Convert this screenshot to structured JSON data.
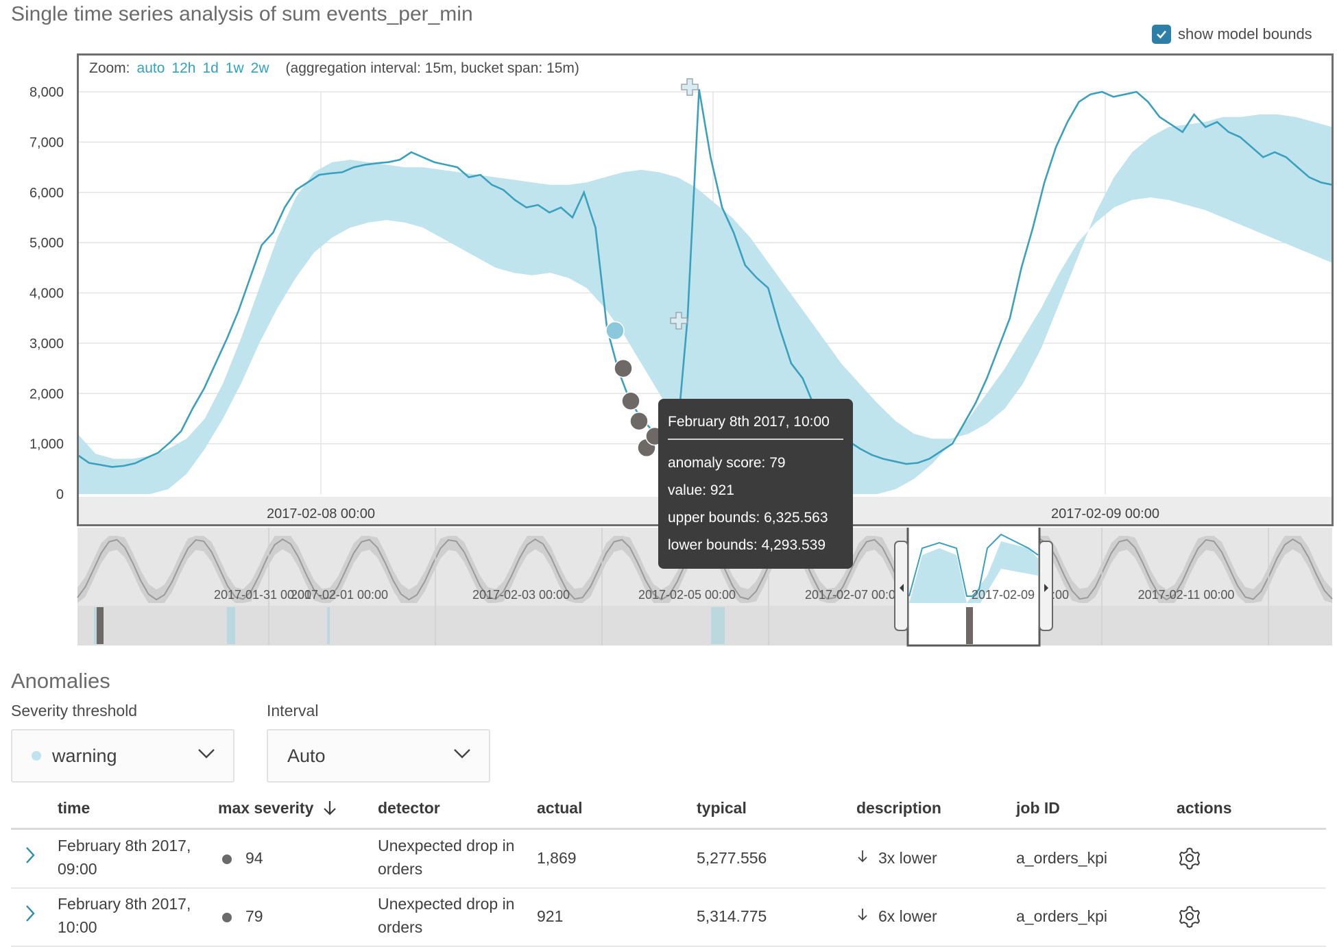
{
  "page": {
    "title": "Single time series analysis of sum events_per_min",
    "show_model_bounds_label": "show model bounds",
    "show_model_bounds_checked": true
  },
  "zoom": {
    "label": "Zoom:",
    "options": [
      "auto",
      "12h",
      "1d",
      "1w",
      "2w"
    ],
    "note": "(aggregation interval: 15m, bucket span: 15m)"
  },
  "colors": {
    "line": "#3aa0be",
    "band": "#bfe4ee",
    "anomaly_dot": "#6e6867",
    "warning_dot": "#8cc8dc",
    "accent": "#2fa3bd"
  },
  "chart_data": {
    "type": "line",
    "ylim": [
      0,
      8000
    ],
    "y_ticks": [
      "8,000",
      "7,000",
      "6,000",
      "5,000",
      "4,000",
      "3,000",
      "2,000",
      "1,000",
      "0"
    ],
    "x_ticks": [
      "2017-02-08 00:00",
      "2017-02-09 00:00"
    ],
    "series": [
      {
        "values": [
          780,
          620,
          580,
          540,
          560,
          610,
          720,
          820,
          1020,
          1250,
          1700,
          2100,
          2600,
          3100,
          3650,
          4300,
          4950,
          5200,
          5700,
          6050,
          6200,
          6350,
          6380,
          6400,
          6500,
          6550,
          6580,
          6600,
          6650,
          6800,
          6700,
          6600,
          6550,
          6500,
          6300,
          6350,
          6150,
          6050,
          5850,
          5700,
          5750,
          5600,
          5700,
          5500,
          6000,
          5300,
          3300,
          2450,
          1850,
          1500,
          1250,
          1150,
          921,
          3500,
          8050,
          6700,
          5700,
          5200,
          4550,
          4300,
          4100,
          3300,
          2600,
          2300,
          1750,
          1500,
          1300,
          1050,
          900,
          780,
          700,
          650,
          600,
          620,
          700,
          850,
          1000,
          1400,
          1800,
          2300,
          2900,
          3500,
          4500,
          5300,
          6200,
          6900,
          7400,
          7800,
          7950,
          8000,
          7900,
          7950,
          8000,
          7800,
          7500,
          7350,
          7200,
          7550,
          7300,
          7400,
          7200,
          7100,
          6900,
          6700,
          6800,
          6700,
          6500,
          6300,
          6200,
          6150
        ]
      }
    ],
    "model_bounds_upper": [
      1200,
      800,
      700,
      700,
      760,
      900,
      1100,
      1500,
      2200,
      3100,
      4100,
      5100,
      5900,
      6400,
      6600,
      6650,
      6600,
      6550,
      6500,
      6500,
      6450,
      6400,
      6350,
      6300,
      6250,
      6200,
      6150,
      6150,
      6200,
      6300,
      6400,
      6450,
      6400,
      6300,
      6100,
      5800,
      5500,
      5100,
      4600,
      4100,
      3600,
      3100,
      2600,
      2200,
      1800,
      1450,
      1200,
      1100,
      1100,
      1200,
      1400,
      1700,
      2200,
      2900,
      3800,
      4700,
      5600,
      6300,
      6800,
      7100,
      7300,
      7350,
      7400,
      7500,
      7500,
      7550,
      7550,
      7500,
      7400,
      7300
    ],
    "model_bounds_lower": [
      0,
      0,
      0,
      0,
      0,
      100,
      400,
      900,
      1500,
      2200,
      3000,
      3700,
      4300,
      4800,
      5100,
      5300,
      5400,
      5450,
      5400,
      5300,
      5100,
      4900,
      4700,
      4500,
      4400,
      4350,
      4400,
      4300,
      4100,
      3700,
      3200,
      2600,
      2000,
      1400,
      900,
      400,
      100,
      0,
      0,
      0,
      0,
      0,
      0,
      0,
      0,
      100,
      300,
      600,
      1000,
      1500,
      2000,
      2500,
      3100,
      3700,
      4400,
      5000,
      5400,
      5700,
      5850,
      5900,
      5850,
      5750,
      5650,
      5500,
      5350,
      5200,
      5050,
      4900,
      4750,
      4600
    ],
    "anomalies": [
      {
        "value": 3250,
        "severity": "warning"
      },
      {
        "value": 2500,
        "severity": "critical"
      },
      {
        "value": 1850,
        "severity": "critical"
      },
      {
        "value": 1450,
        "severity": "critical"
      },
      {
        "value": 921,
        "severity": "critical"
      },
      {
        "value": 1150,
        "severity": "critical"
      }
    ]
  },
  "overview": {
    "x_ticks": [
      "2017-01-31 00:00",
      "2017-02-01 00:00",
      "2017-02-03 00:00",
      "2017-02-05 00:00",
      "2017-02-07 00:00",
      "2017-02-09 00:00",
      "2017-02-11 00:00"
    ]
  },
  "tooltip": {
    "title": "February 8th 2017, 10:00",
    "anomaly_score": "anomaly score: 79",
    "value": "value: 921",
    "upper": "upper bounds: 6,325.563",
    "lower": "lower bounds: 4,293.539"
  },
  "anomalies_section": {
    "title": "Anomalies",
    "severity_label": "Severity threshold",
    "severity_value": "warning",
    "interval_label": "Interval",
    "interval_value": "Auto"
  },
  "table": {
    "headers": {
      "time": "time",
      "max_severity": "max severity",
      "detector": "detector",
      "actual": "actual",
      "typical": "typical",
      "description": "description",
      "job_id": "job ID",
      "actions": "actions"
    },
    "rows": [
      {
        "time_line1": "February 8th 2017,",
        "time_line2": "09:00",
        "severity": "94",
        "detector_line1": "Unexpected drop in",
        "detector_line2": "orders",
        "actual": "1,869",
        "typical": "5,277.556",
        "description": "3x lower",
        "job_id": "a_orders_kpi"
      },
      {
        "time_line1": "February 8th 2017,",
        "time_line2": "10:00",
        "severity": "79",
        "detector_line1": "Unexpected drop in",
        "detector_line2": "orders",
        "actual": "921",
        "typical": "5,314.775",
        "description": "6x lower",
        "job_id": "a_orders_kpi"
      }
    ]
  }
}
